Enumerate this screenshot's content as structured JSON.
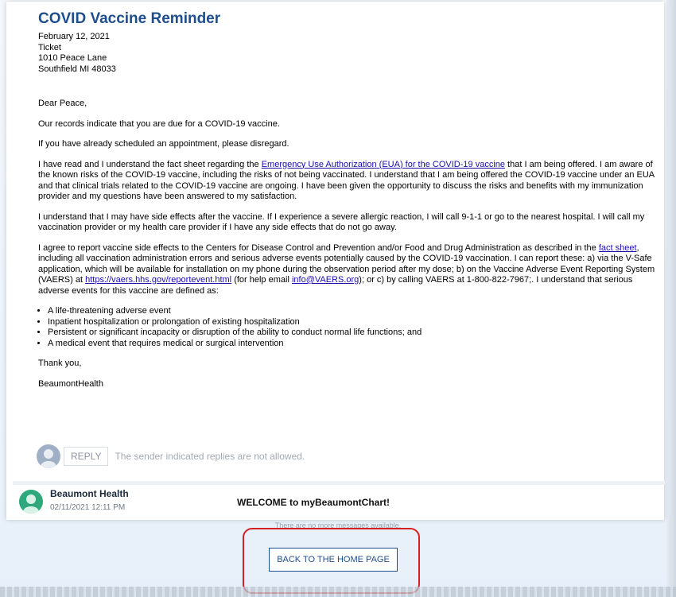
{
  "message": {
    "title": "COVID Vaccine Reminder",
    "date": "February 12, 2021",
    "address_lines": [
      "Ticket",
      "1010 Peace Lane",
      "Southfield MI 48033"
    ],
    "greeting": "Dear Peace,",
    "p1": "Our records indicate that you are due for a COVID-19 vaccine.",
    "p2": "If you have already scheduled an appointment, please disregard.",
    "p3_a": "I have read and I understand the fact sheet regarding the ",
    "p3_link": "Emergency Use Authorization (EUA) for the COVID-19 vaccine",
    "p3_b": " that I am being offered. I am aware of the known risks of the COVID-19 vaccine, including the risks of not being vaccinated. I understand that I am being offered the COVID-19 vaccine under an EUA and that clinical trials related to the COVID-19 vaccine are ongoing. I have been given the opportunity to discuss the risks and benefits with my immunization provider and my questions have been answered to my satisfaction.",
    "p4": "I understand that I may have side effects after the vaccine. If I experience a severe allergic reaction, I will call 9-1-1 or go to the nearest hospital. I will call my vaccination provider or my health care provider if I have any side effects that do not go away.",
    "p5_a": "I agree to report vaccine side effects to the Centers for Disease Control and Prevention and/or Food and Drug Administration as described in the ",
    "p5_link1": "fact sheet",
    "p5_b": ", including all vaccination administration errors and serious adverse events potentially caused by the COVID-19 vaccination. I can report these: a) via the V-Safe application, which will be available for installation on my phone during the observation period after my dose; b) on the Vaccine Adverse Event Reporting System (VAERS) at ",
    "p5_link2": "https://vaers.hhs.gov/reportevent.html",
    "p5_c": " (for help email ",
    "p5_link3": "info@VAERS.org",
    "p5_d": "); or c) by calling VAERS at 1-800-822-7967;. I understand that serious adverse events for this vaccine are defined as:",
    "bullets": [
      "A life-threatening adverse event",
      "Inpatient hospitalization or prolongation of existing hospitalization",
      "Persistent or significant incapacity or disruption of the ability to conduct normal life functions; and",
      "A medical event that requires medical or surgical intervention"
    ],
    "closing": "Thank you,",
    "signature": "BeaumontHealth"
  },
  "reply": {
    "button_label": "REPLY",
    "note": "The sender indicated replies are not allowed."
  },
  "thread": {
    "sender": "Beaumont Health",
    "timestamp": "02/11/2021 12:11 PM",
    "subject": "WELCOME to myBeaumontChart!"
  },
  "footer": {
    "no_more_text": "There are no more messages available.",
    "home_button": "BACK TO THE HOME PAGE"
  },
  "colors": {
    "title": "#1f4e8c",
    "link": "#1a0dab",
    "sender_avatar": "#2fa87c",
    "highlight": "#d42020"
  }
}
